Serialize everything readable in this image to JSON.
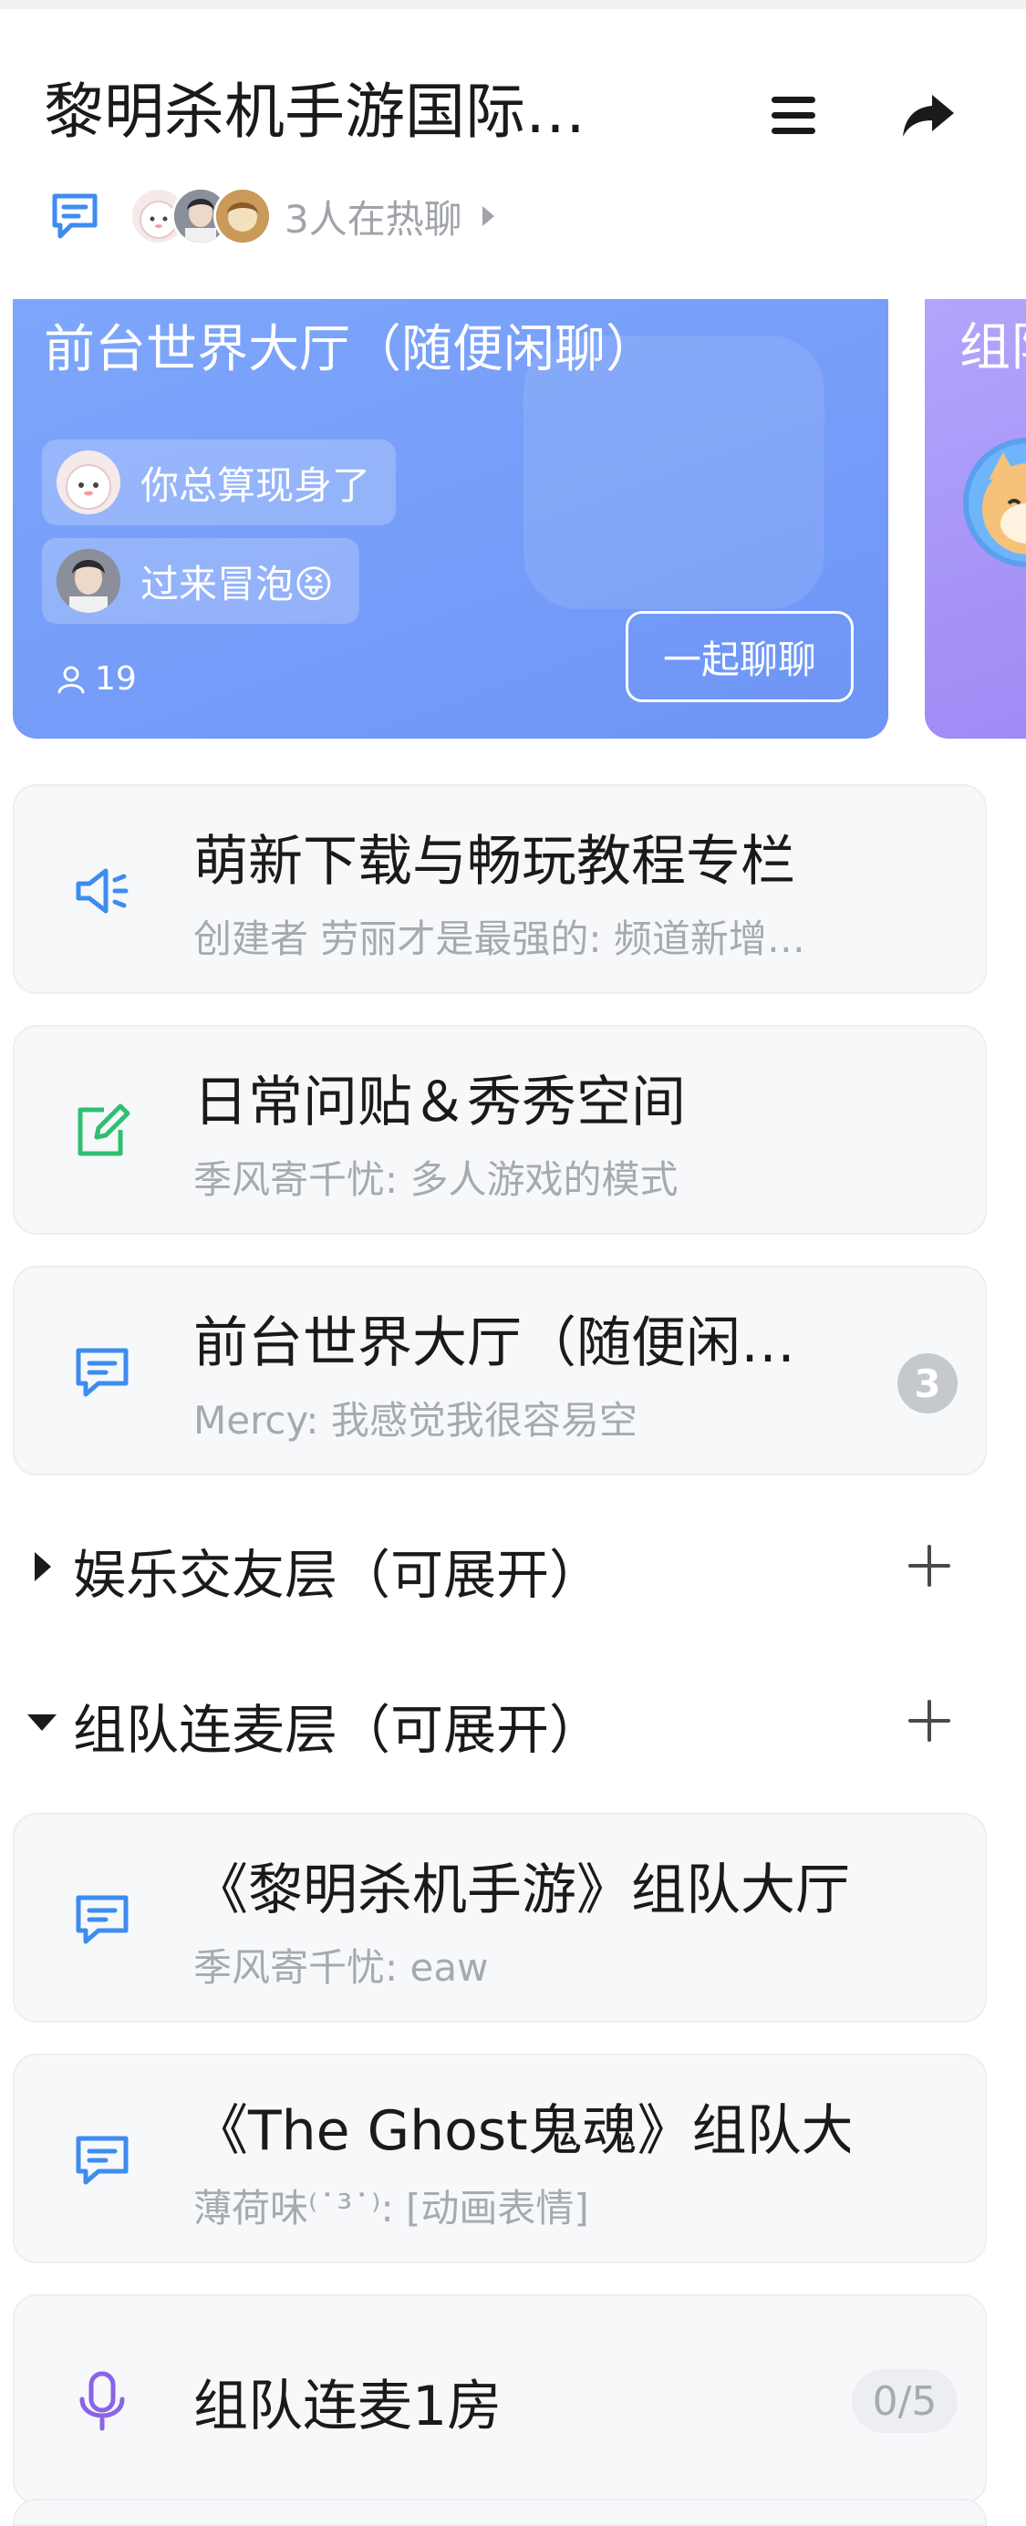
{
  "header": {
    "title": "黎明杀机手游国际…",
    "hot_text": "3人在热聊"
  },
  "featured": [
    {
      "title": "前台世界大厅（随便闲聊）",
      "messages": [
        "你总算现身了",
        "过来冒泡😝"
      ],
      "member_count": "19",
      "join_label": "一起聊聊"
    },
    {
      "title": "组队"
    }
  ],
  "channels": [
    {
      "title": "萌新下载与畅玩教程专栏",
      "subtitle": "创建者 劳丽才是最强的: 频道新增…",
      "icon": "announcement-icon"
    },
    {
      "title": "日常问贴＆秀秀空间",
      "subtitle": "季风寄千忧: 多人游戏的模式",
      "icon": "post-edit-icon"
    },
    {
      "title": "前台世界大厅（随便闲…",
      "subtitle": "Mercy: 我感觉我很容易空",
      "icon": "chat-icon",
      "badge": "3"
    }
  ],
  "sections": [
    {
      "title": "娱乐交友层（可展开）",
      "expanded": false
    },
    {
      "title": "组队连麦层（可展开）",
      "expanded": true
    }
  ],
  "section_channels": [
    {
      "title": "《黎明杀机手游》组队大厅",
      "subtitle": "季风寄千忧: eaw",
      "icon": "chat-icon"
    },
    {
      "title": "《The Ghost鬼魂》组队大厅",
      "subtitle": "薄荷味⁽˙³˙⁾: [动画表情]",
      "icon": "chat-icon"
    },
    {
      "title": "组队连麦1房",
      "capacity": "0/5",
      "icon": "microphone-icon"
    }
  ],
  "colors": {
    "accent_blue": "#3d8cf0",
    "featured_blue": "#7ea6fb",
    "featured_purple": "#a899f8",
    "green": "#2fbf71",
    "purple_icon": "#8a63e8"
  }
}
